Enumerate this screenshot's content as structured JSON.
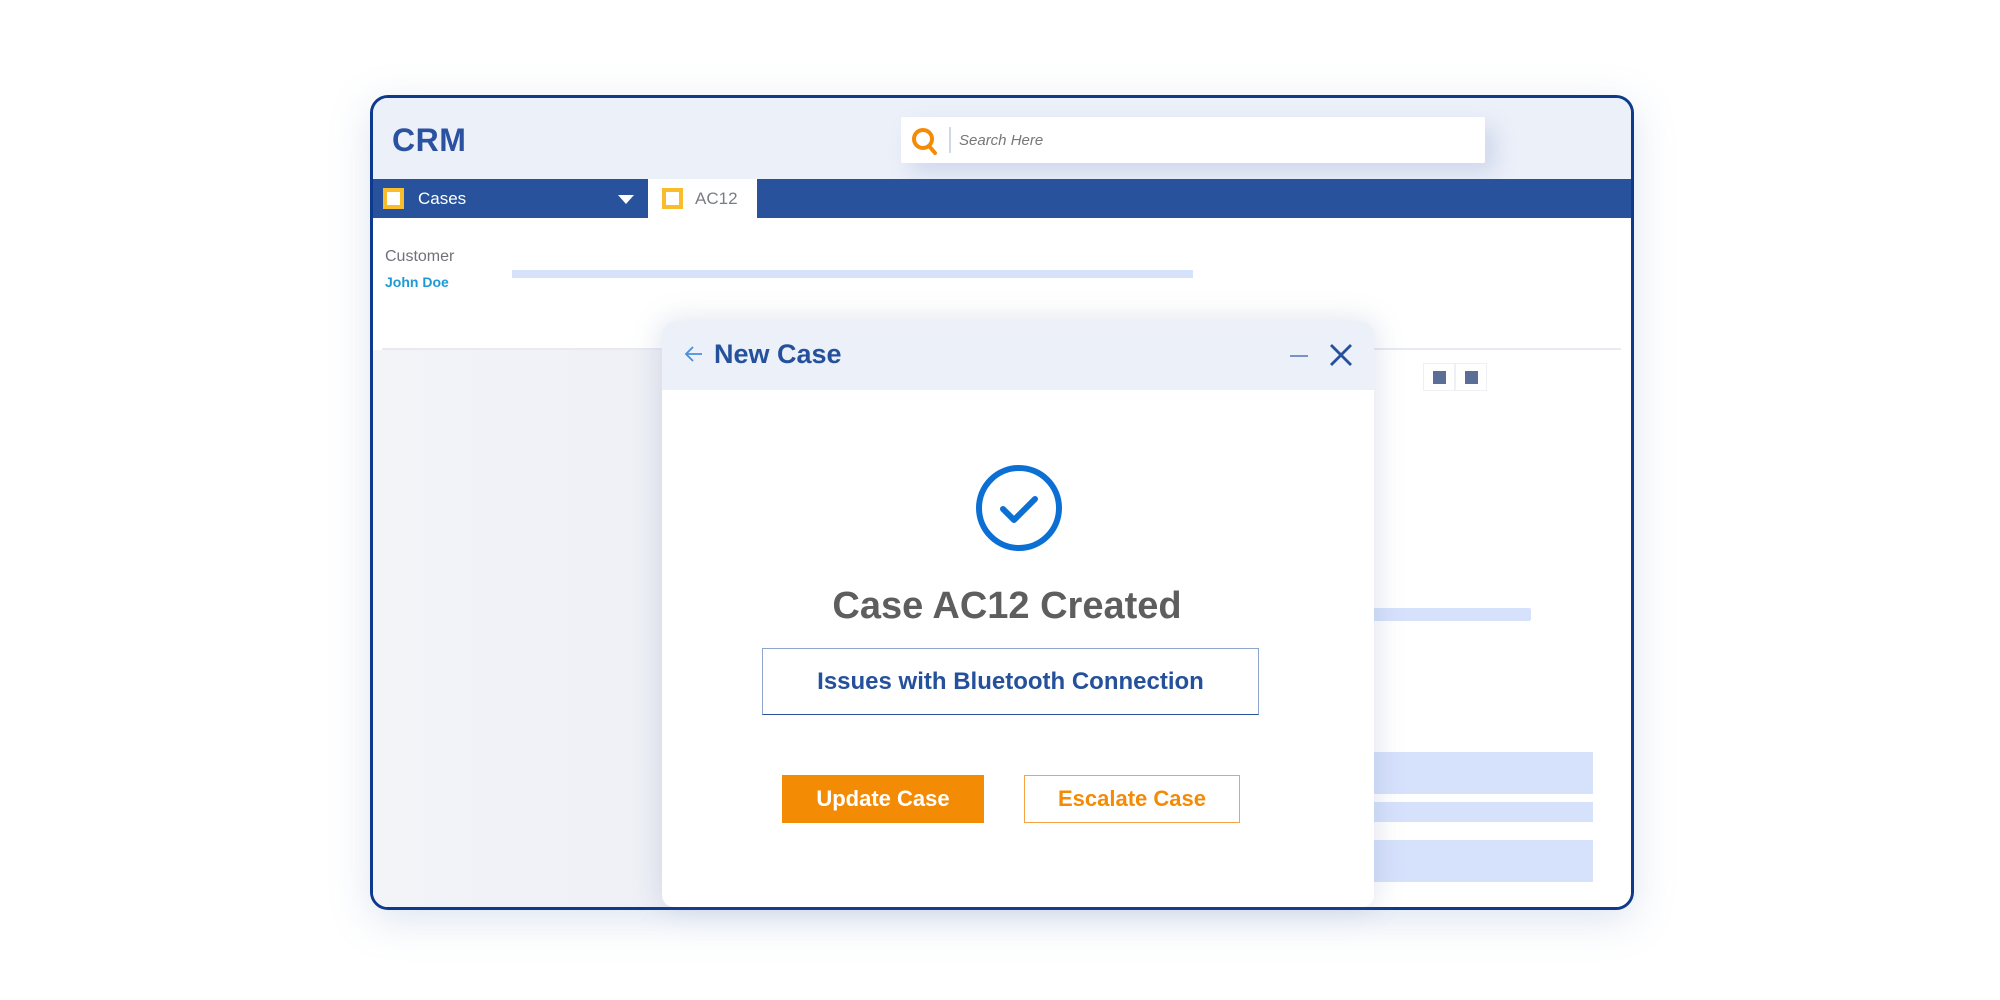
{
  "app": {
    "brand": "CRM",
    "search": {
      "placeholder": "Search Here",
      "value": ""
    },
    "nav": {
      "dropdown_label": "Cases",
      "active_tab_label": "AC12"
    },
    "record": {
      "customer_label": "Customer",
      "customer_name": "John Doe"
    }
  },
  "modal": {
    "title": "New Case",
    "status_message": "Case AC12 Created",
    "case_subject": "Issues with Bluetooth Connection",
    "primary_button": "Update Case",
    "secondary_button": "Escalate Case"
  },
  "colors": {
    "brand_blue": "#28529c",
    "accent_orange": "#f48b05",
    "success_blue": "#0b6fd3",
    "tab_icon_yellow": "#f9bd2c",
    "link_blue": "#1d9ad6"
  },
  "icons": {
    "search": "search-icon",
    "dropdown": "caret-down-icon",
    "back": "arrow-left-icon",
    "minimize": "minimize-icon",
    "close": "close-icon",
    "success": "check-circle-icon"
  }
}
